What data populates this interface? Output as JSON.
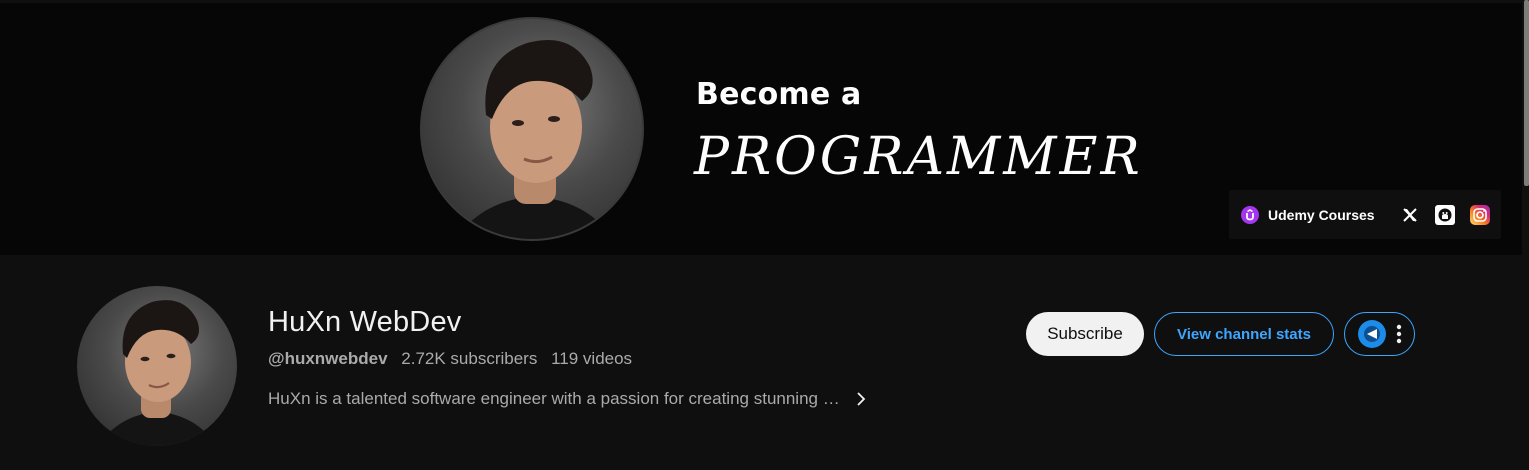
{
  "banner": {
    "heading": "Become a",
    "subheading": "PROGRAMMER",
    "links": {
      "udemy_label": "Udemy Courses",
      "icons": [
        "udemy-icon",
        "x-icon",
        "github-icon",
        "instagram-icon"
      ]
    }
  },
  "channel": {
    "name": "HuXn WebDev",
    "handle": "@huxnwebdev",
    "subscribers": "2.72K subscribers",
    "videos": "119 videos",
    "description": "HuXn is a talented software engineer with a passion for creating stunning …"
  },
  "actions": {
    "subscribe_label": "Subscribe",
    "stats_label": "View channel stats"
  },
  "colors": {
    "background": "#0f0f0f",
    "banner_background": "#060606",
    "accent_blue": "#3ea6ff",
    "subscribe_bg": "#f1f1f1",
    "udemy_purple": "#a435f0",
    "secondary_text": "#aaaaaa"
  }
}
